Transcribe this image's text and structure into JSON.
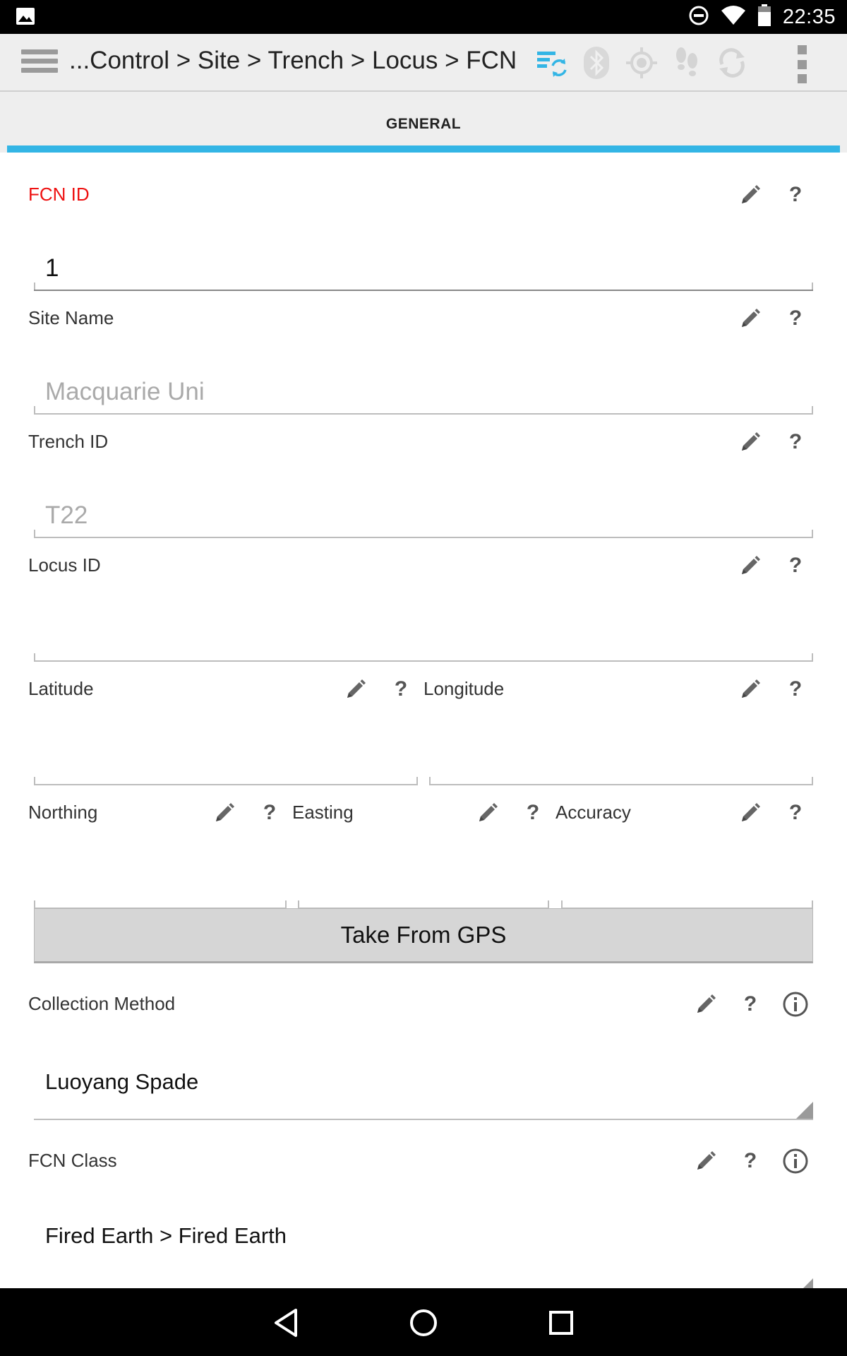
{
  "status_bar": {
    "time": "22:35",
    "icons": [
      "image-notification-icon",
      "do-not-disturb-icon",
      "wifi-icon",
      "battery-icon"
    ]
  },
  "action_bar": {
    "breadcrumb": "...Control > Site > Trench > Locus > FCN",
    "icons": [
      "sync-list-icon",
      "bluetooth-icon",
      "gps-icon",
      "tracking-icon",
      "sync-icon",
      "overflow-menu-icon"
    ],
    "accent_color": "#33b5e5"
  },
  "tabs": [
    {
      "label": "GENERAL",
      "active": true
    }
  ],
  "form": {
    "fcn_id": {
      "label": "FCN ID",
      "value": "1",
      "required": true
    },
    "site_name": {
      "label": "Site Name",
      "placeholder": "Macquarie Uni"
    },
    "trench_id": {
      "label": "Trench ID",
      "placeholder": "T22"
    },
    "locus_id": {
      "label": "Locus ID",
      "value": ""
    },
    "latitude": {
      "label": "Latitude",
      "value": ""
    },
    "longitude": {
      "label": "Longitude",
      "value": ""
    },
    "northing": {
      "label": "Northing",
      "value": ""
    },
    "easting": {
      "label": "Easting",
      "value": ""
    },
    "accuracy": {
      "label": "Accuracy",
      "value": ""
    },
    "gps_button": "Take From GPS",
    "collection_method": {
      "label": "Collection Method",
      "value": "Luoyang Spade"
    },
    "fcn_class": {
      "label": "FCN Class",
      "value": "Fired Earth > Fired Earth"
    },
    "help_glyph": "?"
  },
  "nav_bar": {
    "icons": [
      "back-icon",
      "home-icon",
      "recents-icon"
    ]
  }
}
